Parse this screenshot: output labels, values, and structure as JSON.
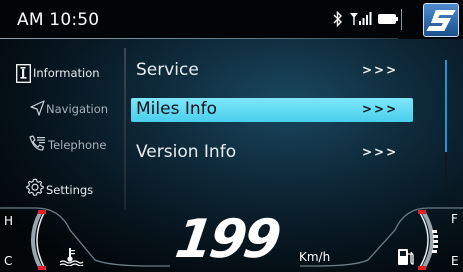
{
  "status": {
    "time": "AM 10:50",
    "icons": [
      "bluetooth-icon",
      "signal-icon",
      "battery-icon",
      "brand-logo-icon"
    ]
  },
  "sidebar": {
    "items": [
      {
        "label": "Information",
        "icon": "info-icon"
      },
      {
        "label": "Navigation",
        "icon": "navigation-arrow-icon"
      },
      {
        "label": "Telephone",
        "icon": "phone-icon"
      },
      {
        "label": "Settings",
        "icon": "gear-icon"
      }
    ]
  },
  "menu": {
    "items": [
      {
        "label": "Service",
        "arrow": ">>>"
      },
      {
        "label": "Miles Info",
        "arrow": ">>>",
        "selected": true
      },
      {
        "label": "Version Info",
        "arrow": ">>>"
      }
    ]
  },
  "cluster": {
    "speed": "199",
    "speed_unit": "Km/h",
    "temp_gauge": {
      "high_label": "H",
      "low_label": "C"
    },
    "fuel_gauge": {
      "full_label": "F",
      "empty_label": "E"
    }
  },
  "colors": {
    "selection": "#5fdcf4",
    "scrollbar": "#2c8fd6",
    "gauge_marker": "#e0202a",
    "logo_blue": "#2f6cb0"
  }
}
